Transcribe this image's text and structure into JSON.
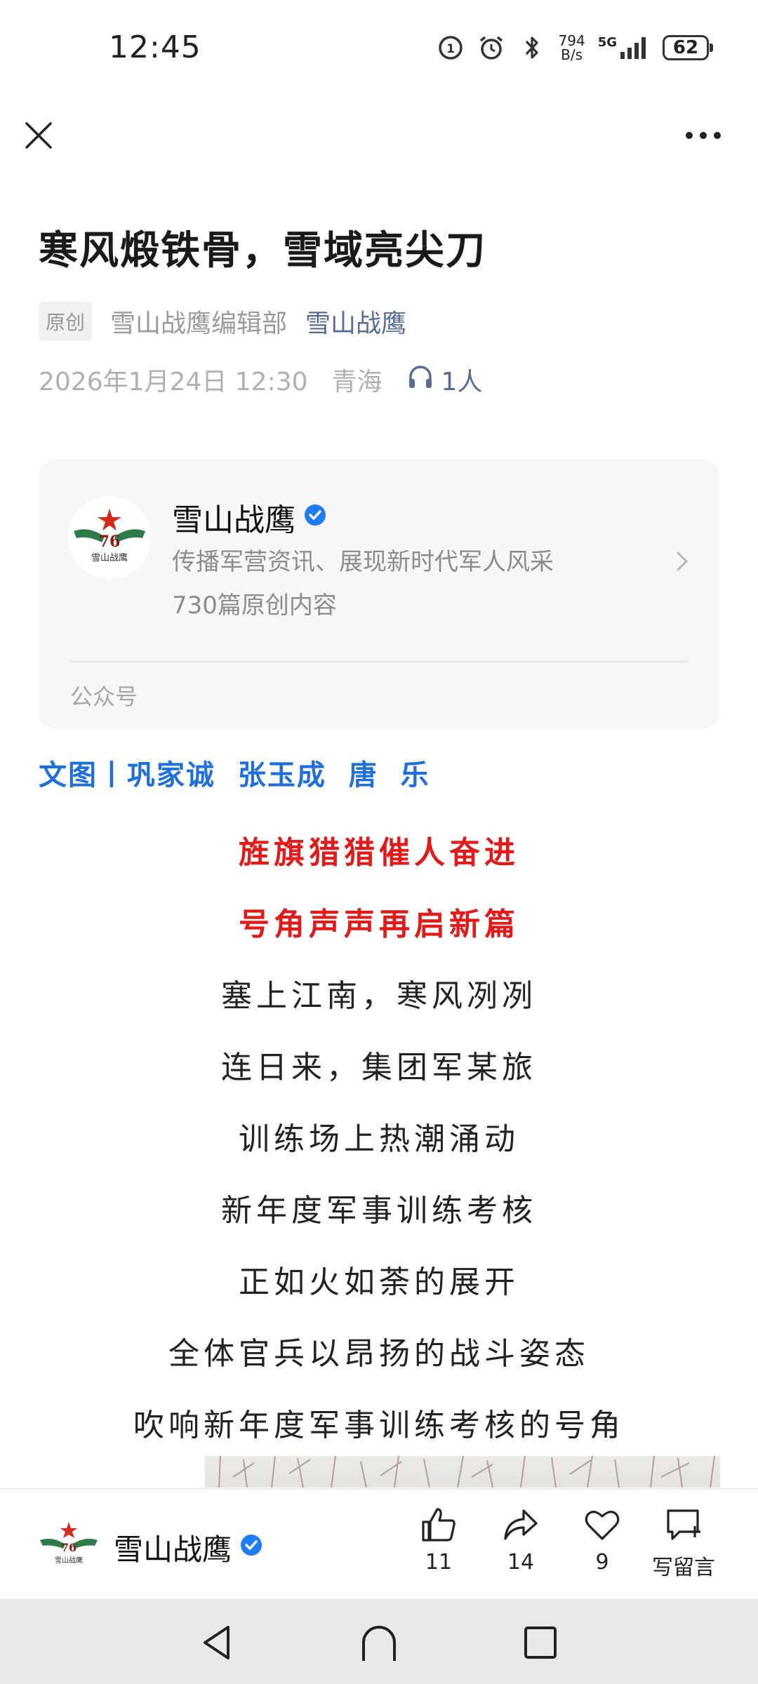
{
  "status_bar": {
    "time": "12:45",
    "net_speed_value": "794",
    "net_speed_unit": "B/s",
    "network": "5G",
    "battery": "62"
  },
  "nav": {
    "close_icon": "close-icon",
    "more_icon": "more-icon"
  },
  "article": {
    "title": "寒风煅铁骨，雪域亮尖刀",
    "original_tag": "原创",
    "author": "雪山战鹰编辑部",
    "account_name": "雪山战鹰",
    "date": "2026年1月24日 12:30",
    "location": "青海",
    "listen_count": "1人"
  },
  "account_card": {
    "name": "雪山战鹰",
    "description": "传播军营资讯、展现新时代军人风采",
    "article_count": "730篇原创内容",
    "type": "公众号",
    "logo_text": "76",
    "logo_caption": "雪山战鹰"
  },
  "byline": "文图丨巩家诚  张玉成  唐  乐",
  "poem": {
    "highlight_lines": [
      "旌旗猎猎催人奋进",
      "号角声声再启新篇"
    ],
    "lines": [
      "塞上江南，寒风冽冽",
      "连日来，集团军某旅",
      "训练场上热潮涌动",
      "新年度军事训练考核",
      "正如火如荼的展开",
      "全体官兵以昂扬的战斗姿态",
      "吹响新年度军事训练考核的号角"
    ]
  },
  "bottom_bar": {
    "account_name": "雪山战鹰",
    "like_count": "11",
    "share_count": "14",
    "favorite_count": "9",
    "comment_label": "写留言"
  },
  "colors": {
    "link": "#576b95",
    "byline": "#1e6fd9",
    "highlight": "#e11a1a",
    "verified": "#1f7bf2"
  }
}
